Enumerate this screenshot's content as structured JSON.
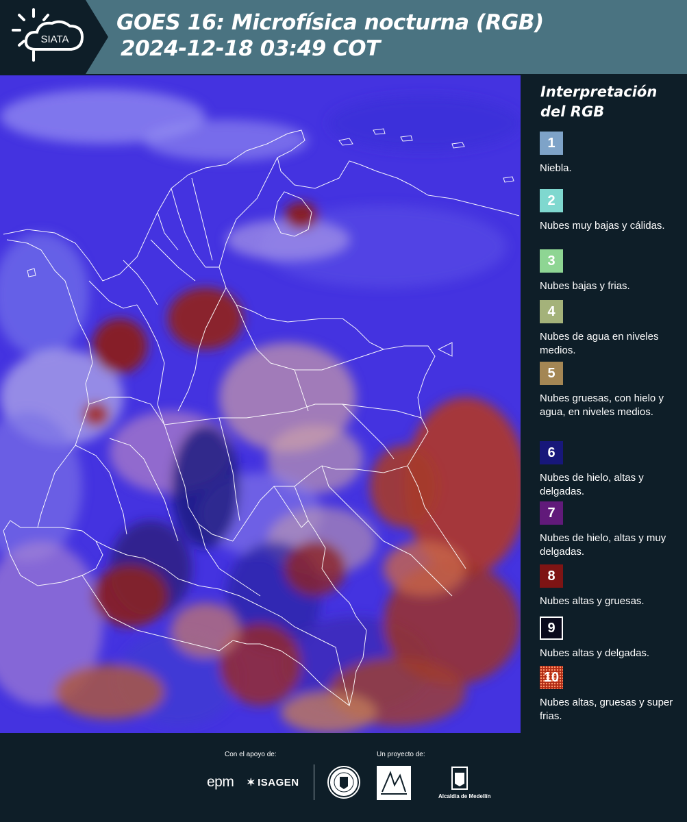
{
  "header": {
    "logo_text": "SIATA",
    "title_line1": "GOES 16: Microfísica nocturna (RGB)",
    "title_line2": "2024-12-18 03:49 COT"
  },
  "legend": {
    "title_line1": "Interpretación",
    "title_line2": "del RGB",
    "items": [
      {
        "number": "1",
        "label": "Niebla.",
        "color": "#7ea3c8"
      },
      {
        "number": "2",
        "label": "Nubes muy bajas y cálidas.",
        "color": "#7fd8cf"
      },
      {
        "number": "3",
        "label": "Nubes bajas y frias.",
        "color": "#8ed593"
      },
      {
        "number": "4",
        "label": "Nubes de agua en niveles medios.",
        "color": "#a4b27a"
      },
      {
        "number": "5",
        "label": "Nubes gruesas, con hielo y agua, en niveles medios.",
        "color": "#a48654"
      },
      {
        "number": "6",
        "label": "Nubes de hielo, altas y delgadas.",
        "color": "#17177a"
      },
      {
        "number": "7",
        "label": "Nubes de hielo, altas y muy delgadas.",
        "color": "#611a7a"
      },
      {
        "number": "8",
        "label": "Nubes altas y gruesas.",
        "color": "#7e1414"
      },
      {
        "number": "9",
        "label": "Nubes altas y delgadas.",
        "color": "#0a0a1c"
      },
      {
        "number": "10",
        "label": "Nubes altas, gruesas y super frias.",
        "color": "#b02a14"
      }
    ]
  },
  "footer": {
    "support_label": "Con el apoyo de:",
    "project_label": "Un proyecto de:",
    "epm": "epm",
    "isagen": "ISAGEN",
    "alcaldia": "Alcaldía de Medellín"
  }
}
